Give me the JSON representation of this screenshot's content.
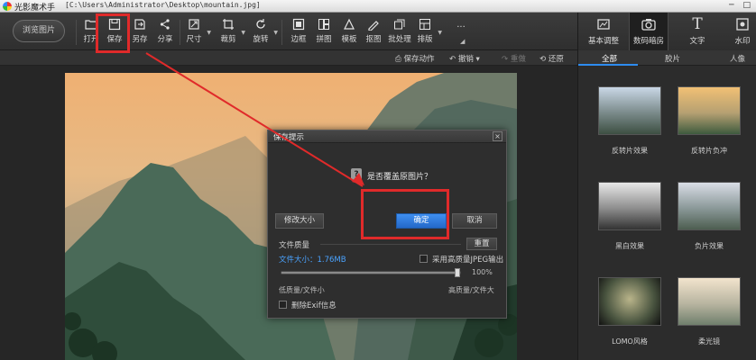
{
  "window": {
    "app_name": "光影魔术手",
    "file_path": "[C:\\Users\\Administrator\\Desktop\\mountain.jpg]"
  },
  "toolbar": {
    "browse_label": "浏览图片",
    "items": [
      {
        "label": "打开",
        "icon": "open-icon"
      },
      {
        "label": "保存",
        "icon": "save-icon"
      },
      {
        "label": "另存",
        "icon": "save-as-icon"
      },
      {
        "label": "分享",
        "icon": "share-icon"
      },
      {
        "label": "尺寸",
        "icon": "resize-icon"
      },
      {
        "label": "裁剪",
        "icon": "crop-icon"
      },
      {
        "label": "旋转",
        "icon": "rotate-icon"
      },
      {
        "label": "边框",
        "icon": "border-icon"
      },
      {
        "label": "拼图",
        "icon": "collage-icon"
      },
      {
        "label": "模板",
        "icon": "template-icon"
      },
      {
        "label": "抠图",
        "icon": "cutout-icon"
      },
      {
        "label": "批处理",
        "icon": "batch-icon"
      },
      {
        "label": "排版",
        "icon": "layout-icon"
      },
      {
        "label": "...",
        "icon": "more-icon"
      }
    ]
  },
  "right_tabs": [
    {
      "label": "基本调整",
      "icon": "adjust-icon"
    },
    {
      "label": "数码暗房",
      "icon": "camera-icon"
    },
    {
      "label": "文字",
      "icon": "text-icon"
    },
    {
      "label": "水印",
      "icon": "watermark-icon"
    }
  ],
  "subbar": {
    "save_action": "保存动作",
    "undo": "撤销",
    "redo": "重做",
    "restore": "还原"
  },
  "panel": {
    "tabs": [
      "全部",
      "胶片",
      "人像"
    ],
    "effects": [
      {
        "label": "反转片效果"
      },
      {
        "label": "反转片负冲"
      },
      {
        "label": "黑白效果"
      },
      {
        "label": "负片效果"
      },
      {
        "label": "LOMO风格"
      },
      {
        "label": "柔光镜"
      }
    ]
  },
  "dialog": {
    "title": "保存提示",
    "close": "×",
    "question": "是否覆盖原图片？",
    "resize_button": "修改大小",
    "ok_button": "确定",
    "cancel_button": "取消",
    "quality_label": "文件质量",
    "reset_button": "重置",
    "file_size": "文件大小：1.76MB",
    "high_quality_jpeg": "采用高质量JPEG输出",
    "quality_percent": "100%",
    "quality_value": 1.0,
    "low_quality": "低质量/文件小",
    "high_quality": "高质量/文件大",
    "delete_exif": "删除Exif信息"
  },
  "colors": {
    "accent_blue": "#2d8cf0",
    "annotation_red": "#e02a2a",
    "dark_bg": "#2a2a2a"
  }
}
